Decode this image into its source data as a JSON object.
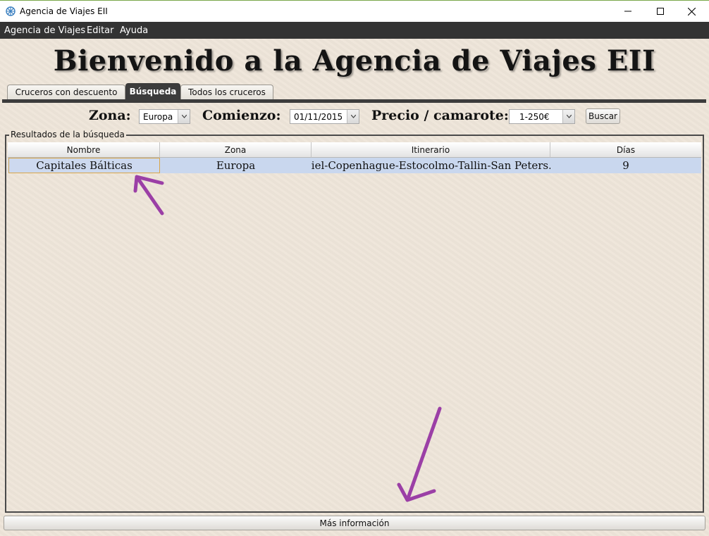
{
  "window": {
    "title": "Agencia de Viajes EII"
  },
  "menubar": {
    "items": [
      "Agencia de Viajes",
      "Editar",
      "Ayuda"
    ]
  },
  "heading": "Bienvenido a la Agencia de Viajes EII",
  "tabs": [
    {
      "label": "Cruceros con descuento",
      "active": false
    },
    {
      "label": "Búsqueda",
      "active": true
    },
    {
      "label": "Todos los cruceros",
      "active": false
    }
  ],
  "search": {
    "zona_label": "Zona:",
    "zona_value": "Europa",
    "comienzo_label": "Comienzo:",
    "comienzo_value": "01/11/2015",
    "precio_label": "Precio / camarote:",
    "precio_value": "1-250€",
    "buscar_label": "Buscar"
  },
  "results": {
    "group_title": "Resultados de la búsqueda",
    "columns": [
      "Nombre",
      "Zona",
      "Itinerario",
      "Días"
    ],
    "rows": [
      [
        "Capitales Bálticas",
        "Europa",
        "Kiel-Copenhague-Estocolmo-Tallin-San Peters...",
        "9"
      ]
    ]
  },
  "footer": {
    "more_info_label": "Más información"
  },
  "colors": {
    "background": "#eee5d9",
    "menubar": "#333333",
    "selected_row": "#c9d7ee",
    "annotation_arrow": "#9b3fa6"
  }
}
